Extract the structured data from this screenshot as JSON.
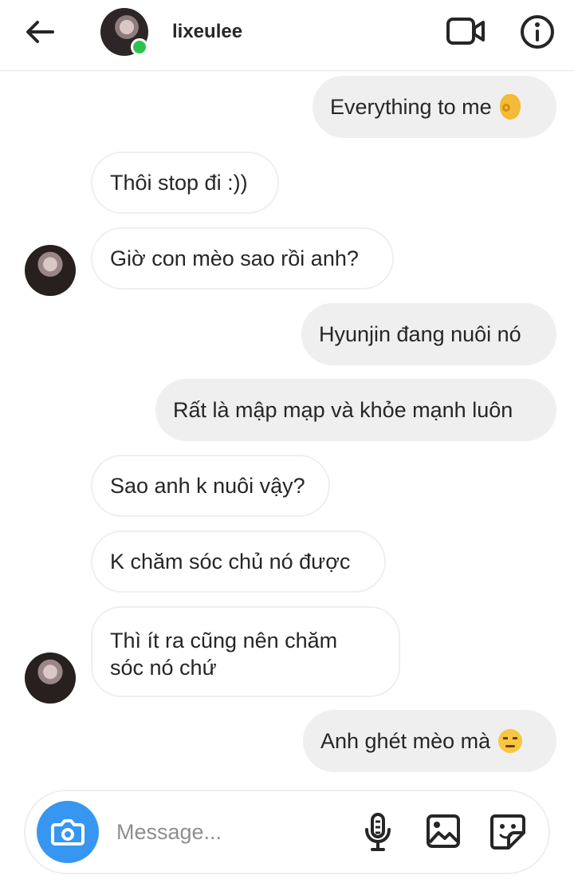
{
  "header": {
    "username": "lixeulee",
    "online": true
  },
  "messages": [
    {
      "side": "out",
      "text": "Everything to me",
      "emoji": "ok-hand"
    },
    {
      "side": "in",
      "text": "Thôi stop đi :))"
    },
    {
      "side": "in",
      "text": "Giờ con mèo sao rồi anh?",
      "avatar": true
    },
    {
      "side": "out",
      "text": "Hyunjin đang nuôi nó"
    },
    {
      "side": "out",
      "text": "Rất là mập mạp và khỏe mạnh luôn"
    },
    {
      "side": "in",
      "text": "Sao anh k nuôi vậy?"
    },
    {
      "side": "in",
      "text": "K chăm sóc chủ nó được"
    },
    {
      "side": "in",
      "text": "Thì ít ra cũng nên chăm sóc nó chứ",
      "avatar": true
    },
    {
      "side": "out",
      "text": "Anh ghét mèo mà",
      "emoji": "unamused"
    }
  ],
  "composer": {
    "placeholder": "Message..."
  },
  "colors": {
    "accent": "#3797f0",
    "online": "#2ec24c",
    "outgoing_bubble": "#efefef",
    "incoming_border": "#efefef"
  },
  "icons": [
    "back-arrow-icon",
    "video-call-icon",
    "info-icon",
    "camera-icon",
    "microphone-icon",
    "gallery-icon",
    "sticker-icon"
  ]
}
